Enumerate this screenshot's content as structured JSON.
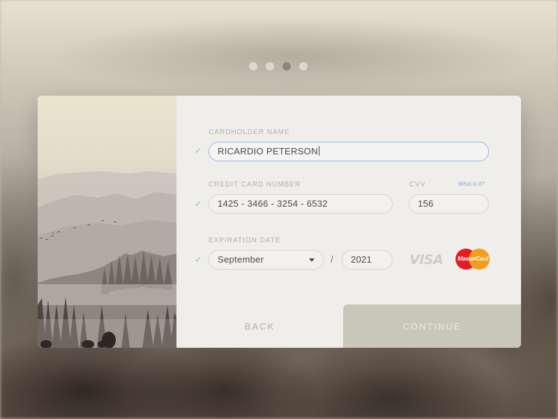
{
  "stepper": {
    "total": 4,
    "active_index": 2
  },
  "form": {
    "cardholder": {
      "label": "CARDHOLDER NAME",
      "value": "RICARDIO PETERSON",
      "check": "✓"
    },
    "card_number": {
      "label": "CREDIT CARD NUMBER",
      "value": "1425 - 3466 - 3254 - 6532",
      "check": "✓"
    },
    "cvv": {
      "label": "CVV",
      "help_link": "What is it?",
      "value": "156"
    },
    "expiration": {
      "label": "EXPIRATION DATE",
      "month": "September",
      "separator": "/",
      "year": "2021",
      "check": "✓"
    },
    "card_brands": {
      "visa": "VISA",
      "mastercard": "MasterCard"
    }
  },
  "buttons": {
    "back": "BACK",
    "continue": "CONTINUE"
  },
  "colors": {
    "accent_focus": "#9fb5df",
    "check_green": "#a7c48a",
    "continue_bg": "#c8c7ba",
    "mastercard_red": "#e61b23",
    "mastercard_orange": "#f59c1a"
  }
}
